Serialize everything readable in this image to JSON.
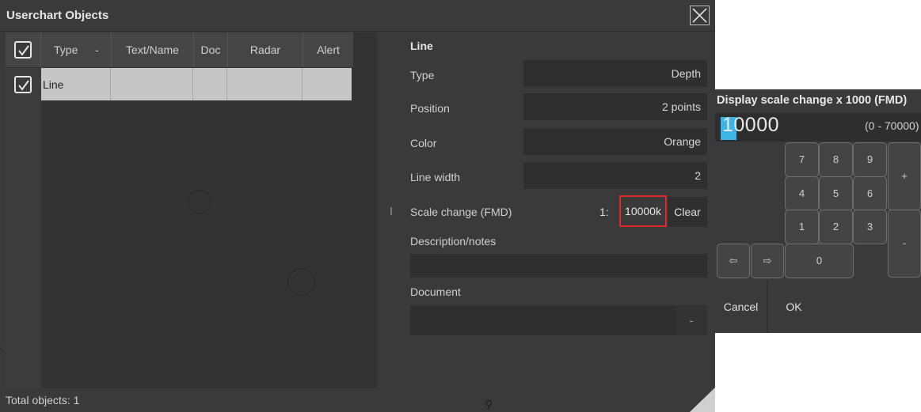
{
  "window": {
    "title": "Userchart Objects"
  },
  "table": {
    "columns": [
      "Type",
      "-",
      "Text/Name",
      "Doc",
      "Radar",
      "Alert"
    ],
    "rows": [
      {
        "type": "Line",
        "text_name": "",
        "doc": "",
        "radar": "",
        "alert": ""
      }
    ]
  },
  "footer": {
    "total": "Total objects: 1"
  },
  "props": {
    "heading": "Line",
    "type_label": "Type",
    "type_value": "Depth",
    "position_label": "Position",
    "position_value": "2 points",
    "color_label": "Color",
    "color_value": "Orange",
    "linewidth_label": "Line width",
    "linewidth_value": "2",
    "scale_label": "Scale change (FMD)",
    "scale_prefix": "1:",
    "scale_value": "10000k",
    "clear_label": "Clear",
    "desc_label": "Description/notes",
    "desc_value": "",
    "doc_label": "Document",
    "doc_value": "",
    "doc_button": "-"
  },
  "keypad": {
    "title": "Display scale change x 1000 (FMD)",
    "value_first": "1",
    "value_rest": "0000",
    "range": "(0 - 70000)",
    "keys": {
      "k7": "7",
      "k8": "8",
      "k9": "9",
      "k4": "4",
      "k5": "5",
      "k6": "6",
      "k1": "1",
      "k2": "2",
      "k3": "3",
      "k0": "0",
      "plus": "+",
      "minus": "-",
      "left": "⇦",
      "right": "⇨"
    },
    "cancel": "Cancel",
    "ok": "OK"
  },
  "colors": {
    "highlight_row": "#c6c6c6",
    "cursor": "#3cb4e6",
    "scale_box_border": "#e02828"
  }
}
